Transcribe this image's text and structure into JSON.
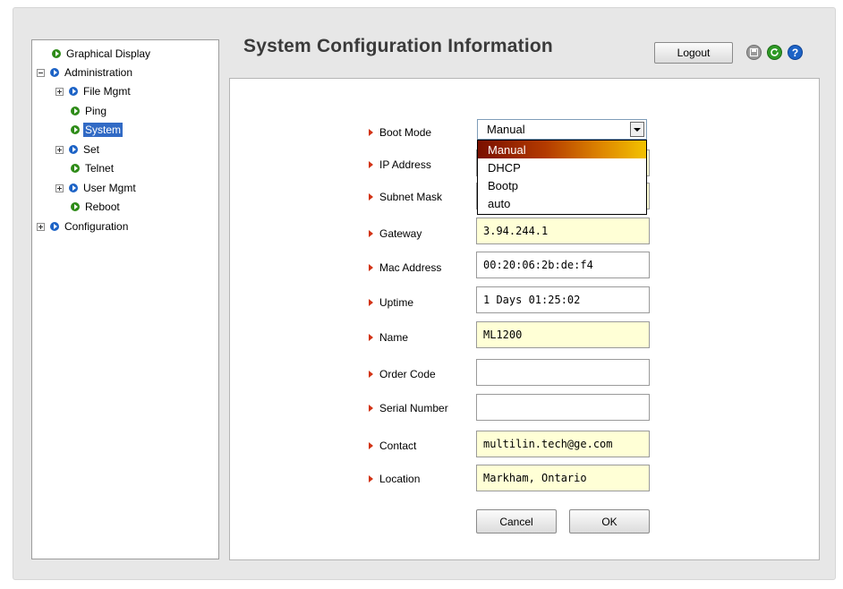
{
  "tree": {
    "items": [
      {
        "label": "Graphical Display"
      },
      {
        "label": "Administration"
      },
      {
        "label": "File Mgmt"
      },
      {
        "label": "Ping"
      },
      {
        "label": "System"
      },
      {
        "label": "Set"
      },
      {
        "label": "Telnet"
      },
      {
        "label": "User Mgmt"
      },
      {
        "label": "Reboot"
      },
      {
        "label": "Configuration"
      }
    ]
  },
  "header": {
    "title": "System Configuration Information",
    "logout_label": "Logout",
    "icons": [
      "save-icon",
      "refresh-icon",
      "help-icon"
    ]
  },
  "form": {
    "boot_mode": {
      "label": "Boot Mode",
      "selected": "Manual",
      "options": [
        "Manual",
        "DHCP",
        "Bootp",
        "auto"
      ],
      "highlighted": "Manual"
    },
    "ip_address": {
      "label": "IP Address"
    },
    "subnet_mask": {
      "label": "Subnet Mask"
    },
    "gateway": {
      "label": "Gateway",
      "value": "3.94.244.1"
    },
    "mac_address": {
      "label": "Mac Address",
      "value": "00:20:06:2b:de:f4"
    },
    "uptime": {
      "label": "Uptime",
      "value": "1 Days 01:25:02"
    },
    "name": {
      "label": "Name",
      "value": "ML1200"
    },
    "order_code": {
      "label": "Order Code",
      "value": ""
    },
    "serial_number": {
      "label": "Serial Number",
      "value": ""
    },
    "contact": {
      "label": "Contact",
      "value": "multilin.tech@ge.com"
    },
    "location": {
      "label": "Location",
      "value": "Markham, Ontario"
    }
  },
  "buttons": {
    "cancel_label": "Cancel",
    "ok_label": "OK"
  },
  "colors": {
    "editable_field_bg": "#ffffd6",
    "selected_tree_bg": "#316ac5",
    "label_arrow": "#d23214"
  }
}
